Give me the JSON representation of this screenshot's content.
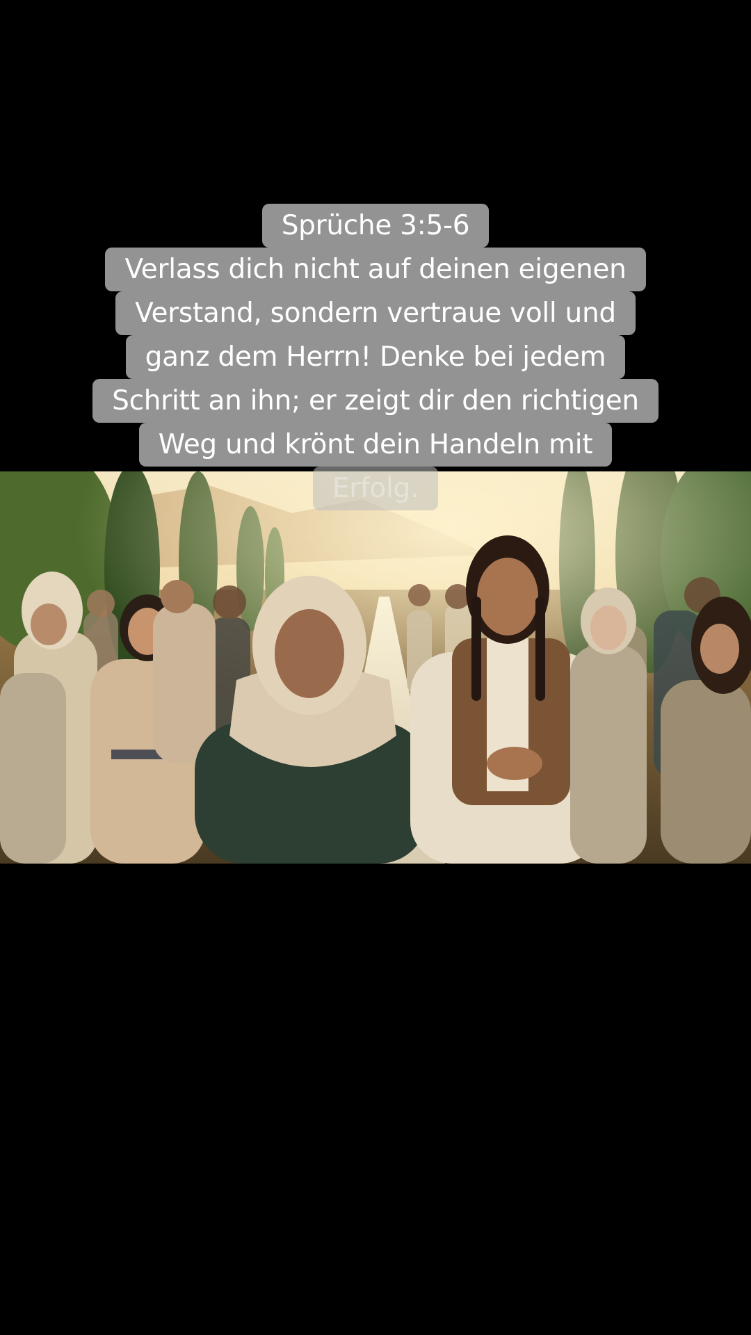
{
  "caption": {
    "reference": "Sprüche 3:5-6",
    "lines": [
      "Verlass dich nicht auf deinen eigenen",
      "Verstand, sondern vertraue voll und",
      "ganz dem Herrn!  Denke bei jedem",
      "Schritt an ihn; er zeigt dir den richtigen",
      "Weg und krönt dein Handeln mit",
      "Erfolg."
    ]
  },
  "colors": {
    "background": "#000000",
    "caption_box": "#a0a0a0",
    "caption_text": "#ffffff"
  }
}
